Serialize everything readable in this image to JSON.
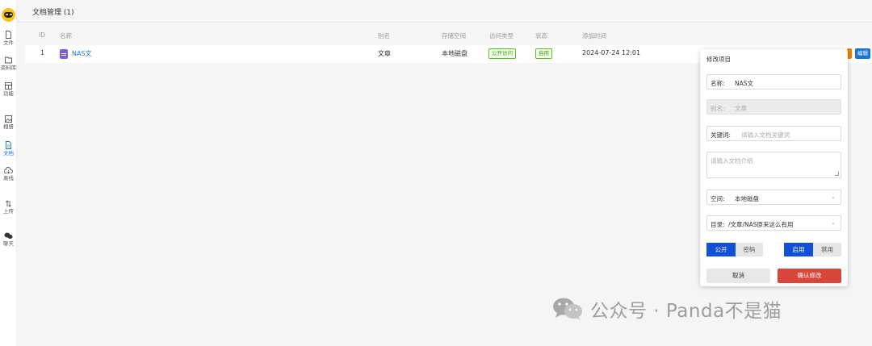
{
  "sidebar": {
    "items": [
      {
        "label": "文件",
        "icon": "file-icon"
      },
      {
        "label": "资料库",
        "icon": "folder-open-icon"
      },
      {
        "label": "功能",
        "icon": "grid-icon"
      },
      {
        "label": "相册",
        "icon": "image-icon"
      },
      {
        "label": "文档",
        "icon": "document-icon"
      },
      {
        "label": "离线",
        "icon": "cloud-download-icon"
      },
      {
        "label": "上传",
        "icon": "upload-arrows-icon"
      },
      {
        "label": "聊天",
        "icon": "chat-icon"
      }
    ],
    "active_index": 4,
    "active_color": "#1976d2"
  },
  "header": {
    "title": "文档管理 (1)"
  },
  "table": {
    "columns": [
      "ID",
      "名称",
      "别名",
      "存储空间",
      "访问类型",
      "状态",
      "添加时间"
    ],
    "rows": [
      {
        "id": "1",
        "name": "NAS文",
        "alias": "文章",
        "storage": "本地磁盘",
        "access": "公开访问",
        "status": "启用",
        "added": "2024-07-24 12:01",
        "edit_label": "编辑"
      }
    ]
  },
  "edit_panel": {
    "title": "修改项目",
    "name_label": "名称:",
    "name_value": "NAS文",
    "alias_label": "别名:",
    "alias_value": "文章",
    "keyword_label": "关键词:",
    "keyword_placeholder": "请输入文档关键词",
    "intro_placeholder": "请输入文档介绍",
    "space_label": "空间:",
    "space_value": "本地磁盘",
    "dir_label": "目录:",
    "dir_value": "/文章/NAS原来这么有用",
    "access_options": [
      "公开",
      "密码"
    ],
    "access_selected": "公开",
    "status_options": [
      "启用",
      "禁用"
    ],
    "status_selected": "启用",
    "cancel_label": "取消",
    "confirm_label": "确认修改",
    "accent_color": "#1050d8",
    "confirm_color": "#d9453b"
  },
  "watermark": {
    "text": "公众号 · Panda不是猫"
  }
}
